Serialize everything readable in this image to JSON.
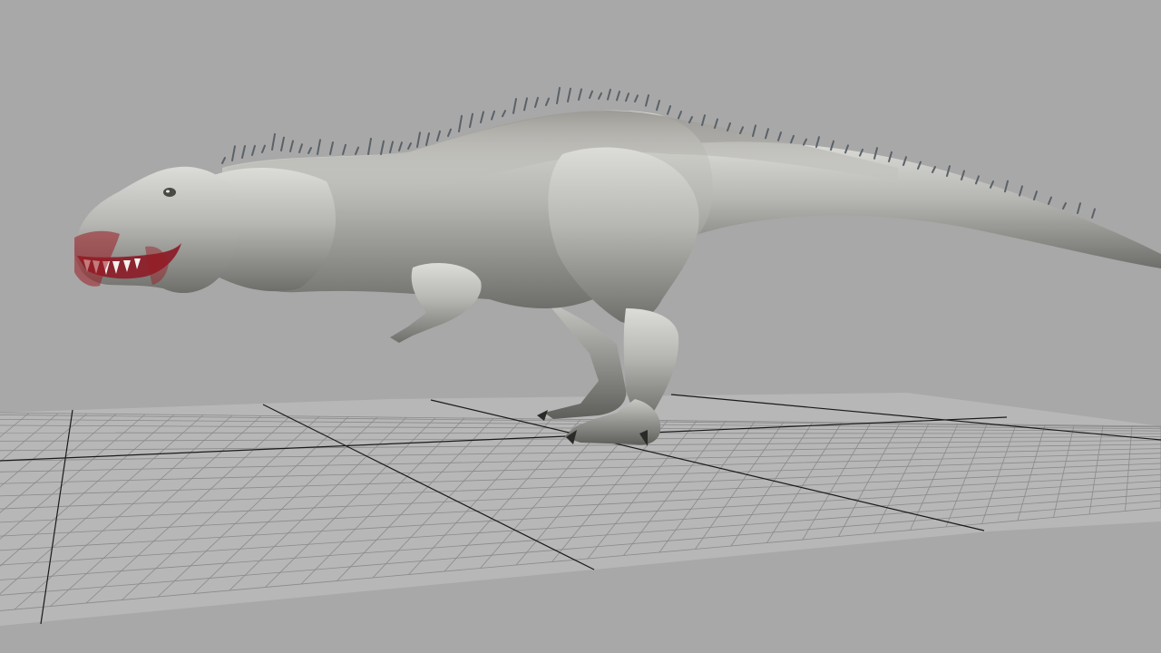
{
  "viewport": {
    "background_color": "#a8a8a8",
    "grid_color": "#c4c4c4",
    "grid_line_color": "#8a8a8a",
    "grid_axis_color": "#1a1a1a",
    "model": {
      "subject": "tyrannosaurus-rex",
      "skin_color": "#b8b8b4",
      "blood_color": "#9a1b22"
    }
  }
}
